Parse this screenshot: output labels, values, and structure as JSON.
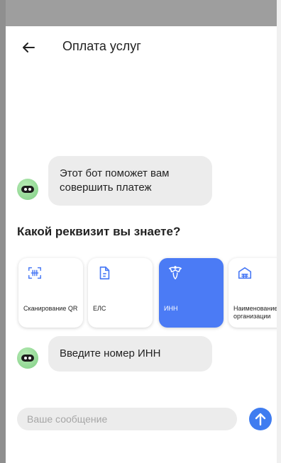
{
  "header": {
    "title": "Оплата услуг",
    "back_icon": "arrow-left-icon"
  },
  "chat": {
    "bot_message_1": "Этот бот поможет вам совершить платеж",
    "question": "Какой реквизит вы знаете?",
    "bot_message_2": "Введите номер ИНН"
  },
  "options": [
    {
      "label": "Сканирование QR",
      "icon": "qr-scan-icon",
      "selected": false
    },
    {
      "label": "ЕЛС",
      "icon": "document-icon",
      "selected": false
    },
    {
      "label": "ИНН",
      "icon": "emblem-icon",
      "selected": true
    },
    {
      "label": "Наименование организации",
      "icon": "building-icon",
      "selected": false
    }
  ],
  "composer": {
    "placeholder": "Ваше сообщение",
    "send_icon": "arrow-up-icon"
  },
  "colors": {
    "accent": "#4b7bf5",
    "send_button": "#3f7cf0",
    "bubble": "#ececec",
    "avatar": "#7fcf84"
  }
}
